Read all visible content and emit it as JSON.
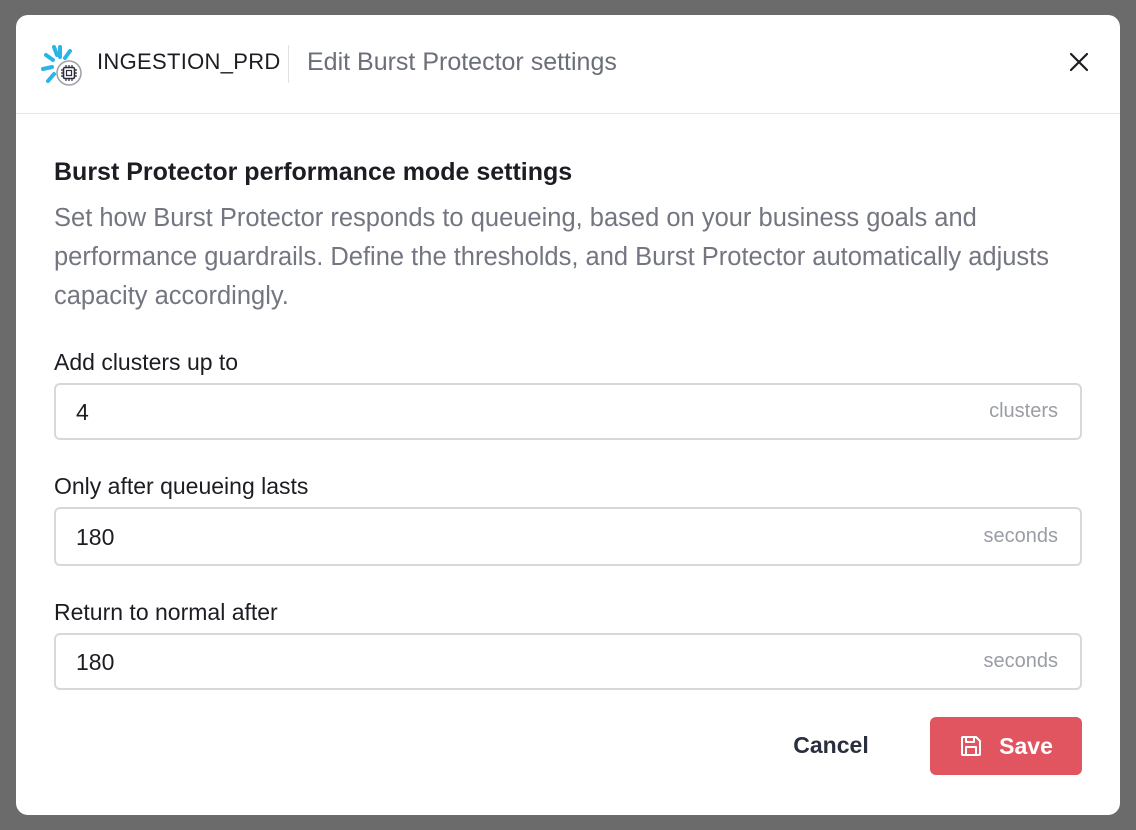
{
  "header": {
    "warehouse_name": "INGESTION_PRD",
    "title": "Edit Burst Protector settings",
    "close_icon": "close-icon",
    "logo_icon": "snowflake-chip-icon"
  },
  "section": {
    "title": "Burst Protector performance mode settings",
    "description": "Set how Burst Protector responds to queueing, based on your business goals and performance guardrails. Define the thresholds, and Burst Protector automatically adjusts capacity accordingly."
  },
  "fields": [
    {
      "label": "Add clusters up to",
      "value": "4",
      "unit": "clusters"
    },
    {
      "label": "Only after queueing lasts",
      "value": "180",
      "unit": "seconds"
    },
    {
      "label": "Return to normal after",
      "value": "180",
      "unit": "seconds"
    }
  ],
  "actions": {
    "cancel_label": "Cancel",
    "save_label": "Save",
    "save_icon": "floppy-disk-icon"
  },
  "colors": {
    "accent": "#e05560",
    "logo_blue": "#29b5e8",
    "backdrop": "#6b6b6b"
  }
}
